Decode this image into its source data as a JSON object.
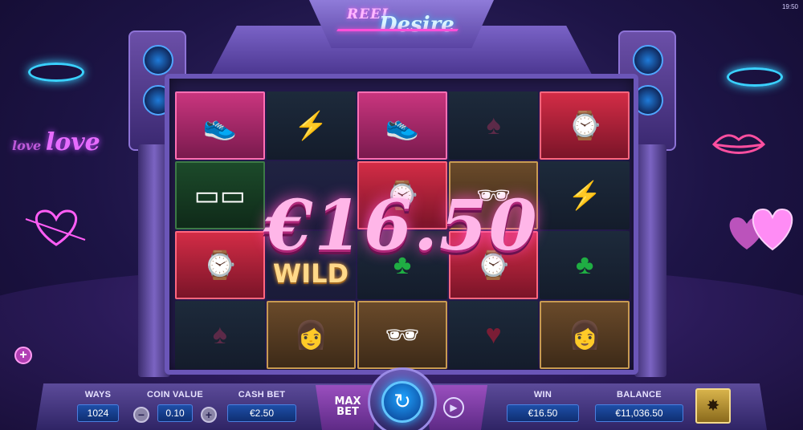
{
  "game": {
    "logo_top": "REEL",
    "logo_bottom": "Desire",
    "clock": "19:50"
  },
  "decor": {
    "love_small": "love",
    "love_big": "love"
  },
  "win_overlay": {
    "amount": "€16.50",
    "wild_label": "WILD"
  },
  "reels": [
    [
      "sneakers",
      "earrings",
      "sneakers",
      "spade",
      "watch"
    ],
    [
      "glasses",
      "wild",
      "watch",
      "man",
      "earrings"
    ],
    [
      "watch",
      "wild",
      "club",
      "watch",
      "club"
    ],
    [
      "spade",
      "woman",
      "man",
      "heart",
      "woman"
    ]
  ],
  "controls": {
    "ways_label": "WAYS",
    "ways_value": "1024",
    "coin_value_label": "COIN VALUE",
    "coin_value": "0.10",
    "coin_minus": "−",
    "coin_plus": "+",
    "cash_bet_label": "CASH BET",
    "cash_bet_value": "€2.50",
    "max_bet_line1": "MAX",
    "max_bet_line2": "BET",
    "spin_icon": "↻",
    "autoplay_icon": "▶",
    "win_label": "WIN",
    "win_value": "€16.50",
    "balance_label": "BALANCE",
    "balance_value": "€11,036.50",
    "extra_button": "+",
    "menu_icon": "✸"
  },
  "colors": {
    "accent_pink": "#ff4fc4",
    "accent_blue": "#2ab0ff",
    "field_blue": "#1e4fa8"
  }
}
